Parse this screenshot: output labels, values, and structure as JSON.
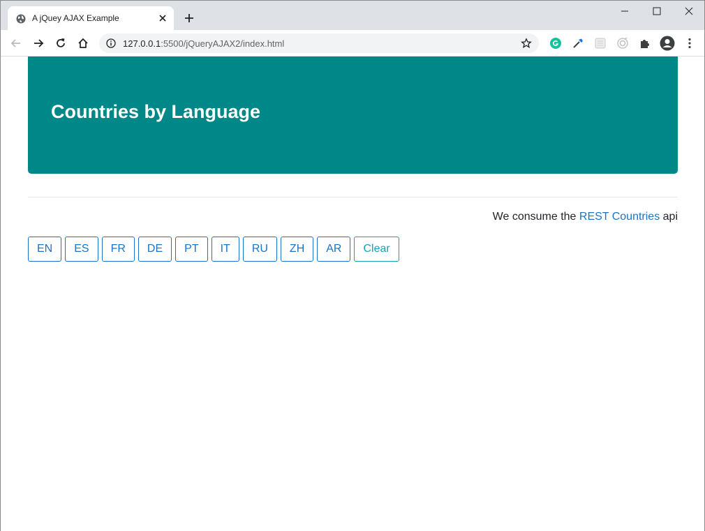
{
  "browser": {
    "tab_title": "A jQuey AJAX Example",
    "url_host": "127.0.0.1",
    "url_rest": ":5500/jQueryAJAX2/index.html",
    "icons": [
      "globe-icon",
      "close-icon",
      "plus-icon",
      "minimize-icon",
      "maximize-icon",
      "window-close-icon",
      "back-icon",
      "forward-icon",
      "reload-icon",
      "home-icon",
      "info-icon",
      "star-icon",
      "grammarly-icon",
      "eyedropper-icon",
      "extension-icon",
      "puzzle-icon",
      "profile-icon",
      "menu-icon"
    ]
  },
  "page": {
    "title": "Countries by Language",
    "attribution_prefix": "We consume the ",
    "attribution_link": "REST Countries",
    "attribution_suffix": " api",
    "buttons": [
      "EN",
      "ES",
      "FR",
      "DE",
      "PT",
      "IT",
      "RU",
      "ZH",
      "AR"
    ],
    "clear_label": "Clear"
  },
  "colors": {
    "jumbotron": "#008787",
    "link": "#1a73c8",
    "clear": "#17a2b8"
  }
}
